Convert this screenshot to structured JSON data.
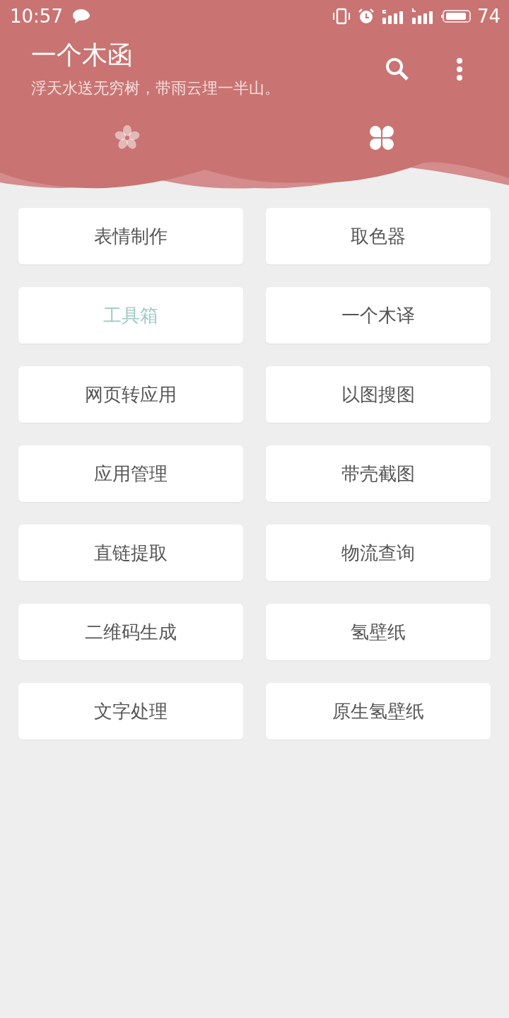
{
  "status_bar": {
    "time": "10:57",
    "battery": "74"
  },
  "header": {
    "title": "一个木函",
    "subtitle": "浮天水送无穷树，带雨云埋一半山。"
  },
  "tabs": [
    {
      "kind": "flower",
      "selected": false
    },
    {
      "kind": "grid",
      "selected": true
    }
  ],
  "tools": [
    {
      "label": "表情制作",
      "highlighted": false
    },
    {
      "label": "取色器",
      "highlighted": false
    },
    {
      "label": "工具箱",
      "highlighted": true
    },
    {
      "label": "一个木译",
      "highlighted": false
    },
    {
      "label": "网页转应用",
      "highlighted": false
    },
    {
      "label": "以图搜图",
      "highlighted": false
    },
    {
      "label": "应用管理",
      "highlighted": false
    },
    {
      "label": "带壳截图",
      "highlighted": false
    },
    {
      "label": "直链提取",
      "highlighted": false
    },
    {
      "label": "物流查询",
      "highlighted": false
    },
    {
      "label": "二维码生成",
      "highlighted": false
    },
    {
      "label": "氢壁纸",
      "highlighted": false
    },
    {
      "label": "文字处理",
      "highlighted": false
    },
    {
      "label": "原生氢壁纸",
      "highlighted": false
    }
  ]
}
